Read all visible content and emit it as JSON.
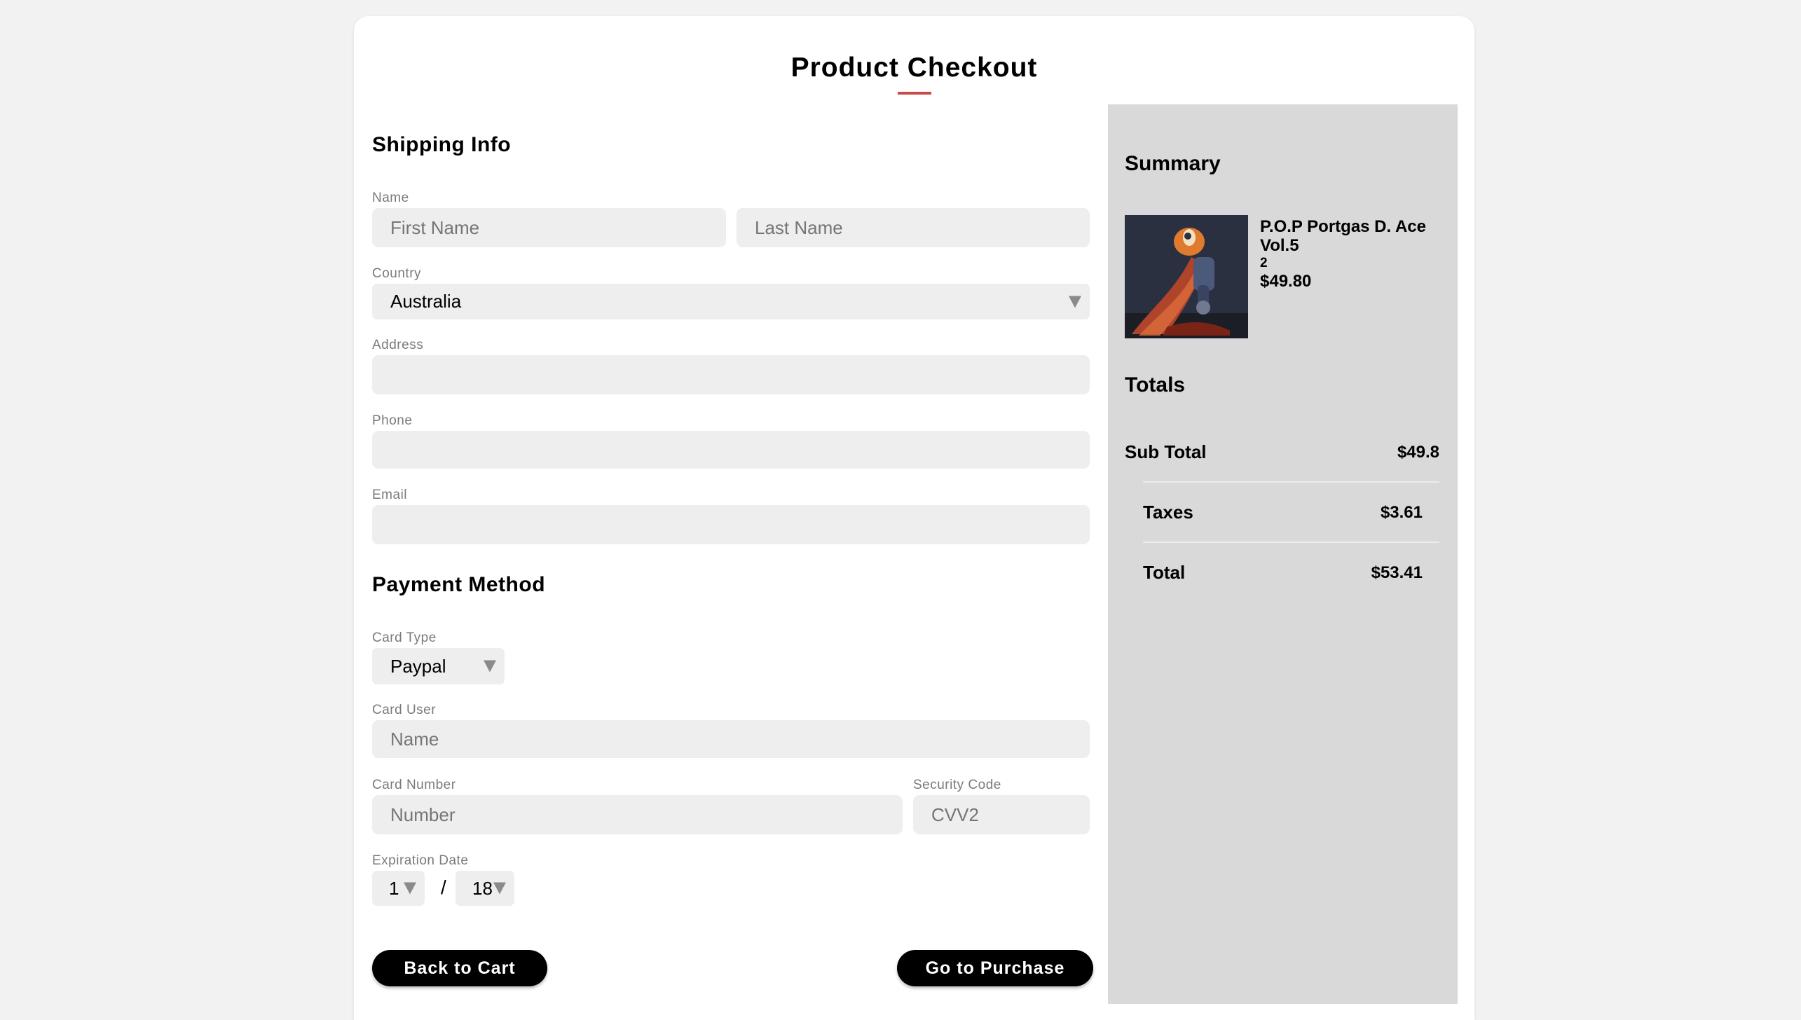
{
  "header": {
    "title": "Product Checkout"
  },
  "shipping": {
    "heading": "Shipping Info",
    "name_label": "Name",
    "first_name_placeholder": "First Name",
    "last_name_placeholder": "Last Name",
    "country_label": "Country",
    "country_value": "Australia",
    "address_label": "Address",
    "phone_label": "Phone",
    "email_label": "Email"
  },
  "payment": {
    "heading": "Payment Method",
    "card_type_label": "Card Type",
    "card_type_value": "Paypal",
    "card_user_label": "Card User",
    "card_user_placeholder": "Name",
    "card_number_label": "Card Number",
    "card_number_placeholder": "Number",
    "security_code_label": "Security Code",
    "security_code_placeholder": "CVV2",
    "expiration_label": "Expiration Date",
    "exp_month": "1",
    "exp_separator": "/",
    "exp_year": "18"
  },
  "actions": {
    "back_label": "Back to Cart",
    "purchase_label": "Go to Purchase"
  },
  "summary": {
    "heading": "Summary",
    "product": {
      "name": "P.O.P Portgas D. Ace Vol.5",
      "quantity": "2",
      "price": "$49.80"
    }
  },
  "totals": {
    "heading": "Totals",
    "subtotal_label": "Sub Total",
    "subtotal_value": "$49.8",
    "taxes_label": "Taxes",
    "taxes_value": "$3.61",
    "total_label": "Total",
    "total_value": "$53.41"
  },
  "colors": {
    "accent": "#c94a47",
    "field_bg": "#eeeeee",
    "summary_bg": "#d9d9d9",
    "button_bg": "#000000"
  },
  "icons": {
    "dropdown": "triangle-down-icon",
    "product_image": "action-figure-image"
  }
}
